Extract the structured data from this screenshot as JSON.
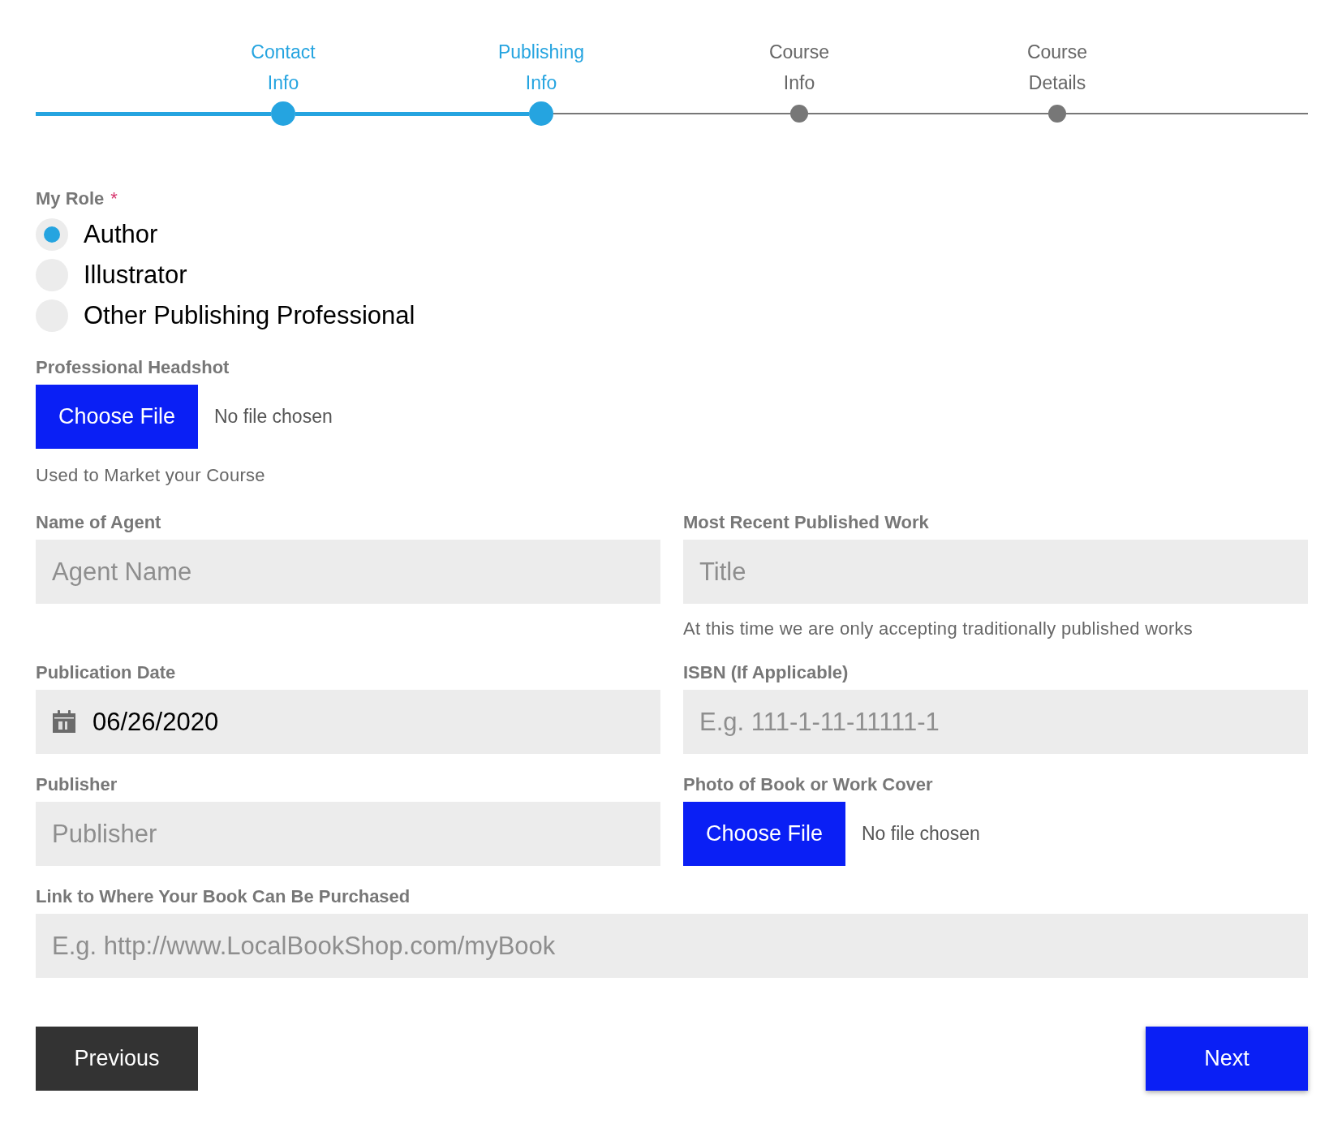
{
  "steps": [
    {
      "label": "Contact Info",
      "done": true
    },
    {
      "label": "Publishing Info",
      "done": true
    },
    {
      "label": "Course Info",
      "done": false
    },
    {
      "label": "Course Details",
      "done": false
    }
  ],
  "role": {
    "label": "My Role",
    "required_mark": "*",
    "options": [
      {
        "label": "Author",
        "selected": true
      },
      {
        "label": "Illustrator",
        "selected": false
      },
      {
        "label": "Other Publishing Professional",
        "selected": false
      }
    ]
  },
  "headshot": {
    "label": "Professional Headshot",
    "button": "Choose File",
    "status": "No file chosen",
    "hint": "Used to Market your Course"
  },
  "fields": [
    {
      "kind": "text",
      "label": "Name of Agent",
      "placeholder": "Agent Name"
    },
    {
      "kind": "text",
      "label": "Most Recent Published Work",
      "placeholder": "Title",
      "hint": "At this time we are only accepting traditionally published works"
    },
    {
      "kind": "date",
      "label": "Publication Date",
      "value": "06/26/2020"
    },
    {
      "kind": "text",
      "label": "ISBN (If Applicable)",
      "placeholder": "E.g. 111-1-11-11111-1"
    },
    {
      "kind": "text",
      "label": "Publisher",
      "placeholder": "Publisher"
    },
    {
      "kind": "file",
      "label": "Photo of Book or Work Cover",
      "button": "Choose File",
      "status": "No file chosen"
    },
    {
      "kind": "wide",
      "label": "Link to Where Your Book Can Be Purchased",
      "placeholder": "E.g. http://www.LocalBookShop.com/myBook"
    }
  ],
  "buttons": {
    "previous": "Previous",
    "next": "Next"
  }
}
